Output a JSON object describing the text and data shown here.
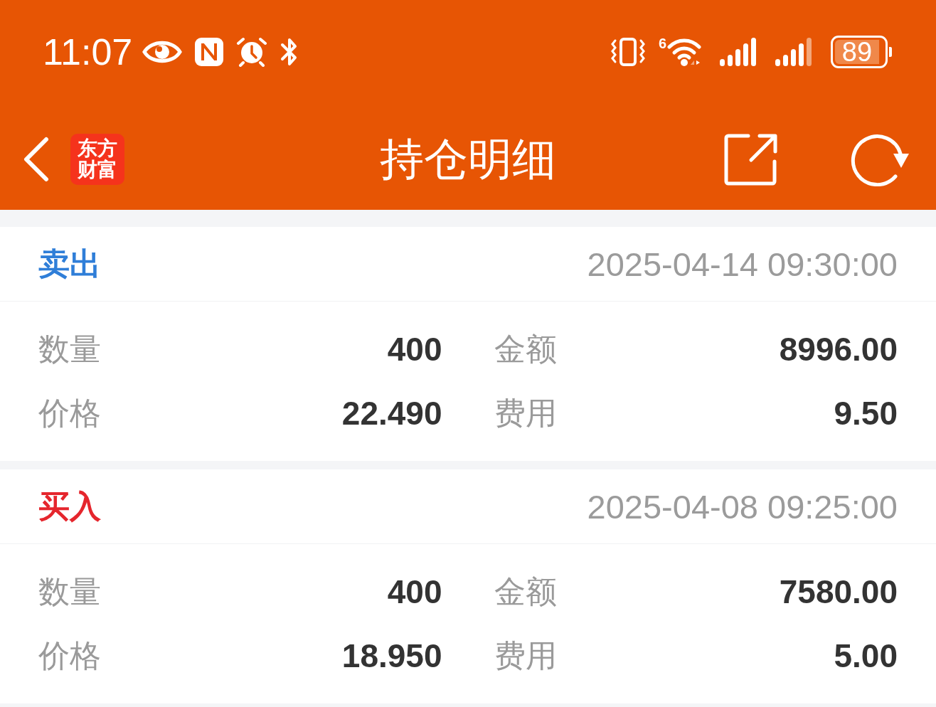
{
  "status_bar": {
    "time": "11:07",
    "wifi_badge": "6",
    "battery": "89"
  },
  "nav": {
    "logo_lines": [
      "东方",
      "财富"
    ],
    "title": "持仓明细"
  },
  "trades": [
    {
      "kind": "sell",
      "type_label": "卖出",
      "datetime": "2025-04-14 09:30:00",
      "fields": [
        {
          "label": "数量",
          "value": "400"
        },
        {
          "label": "金额",
          "value": "8996.00"
        },
        {
          "label": "价格",
          "value": "22.490"
        },
        {
          "label": "费用",
          "value": "9.50"
        }
      ]
    },
    {
      "kind": "buy",
      "type_label": "买入",
      "datetime": "2025-04-08 09:25:00",
      "fields": [
        {
          "label": "数量",
          "value": "400"
        },
        {
          "label": "金额",
          "value": "7580.00"
        },
        {
          "label": "价格",
          "value": "18.950"
        },
        {
          "label": "费用",
          "value": "5.00"
        }
      ]
    }
  ]
}
